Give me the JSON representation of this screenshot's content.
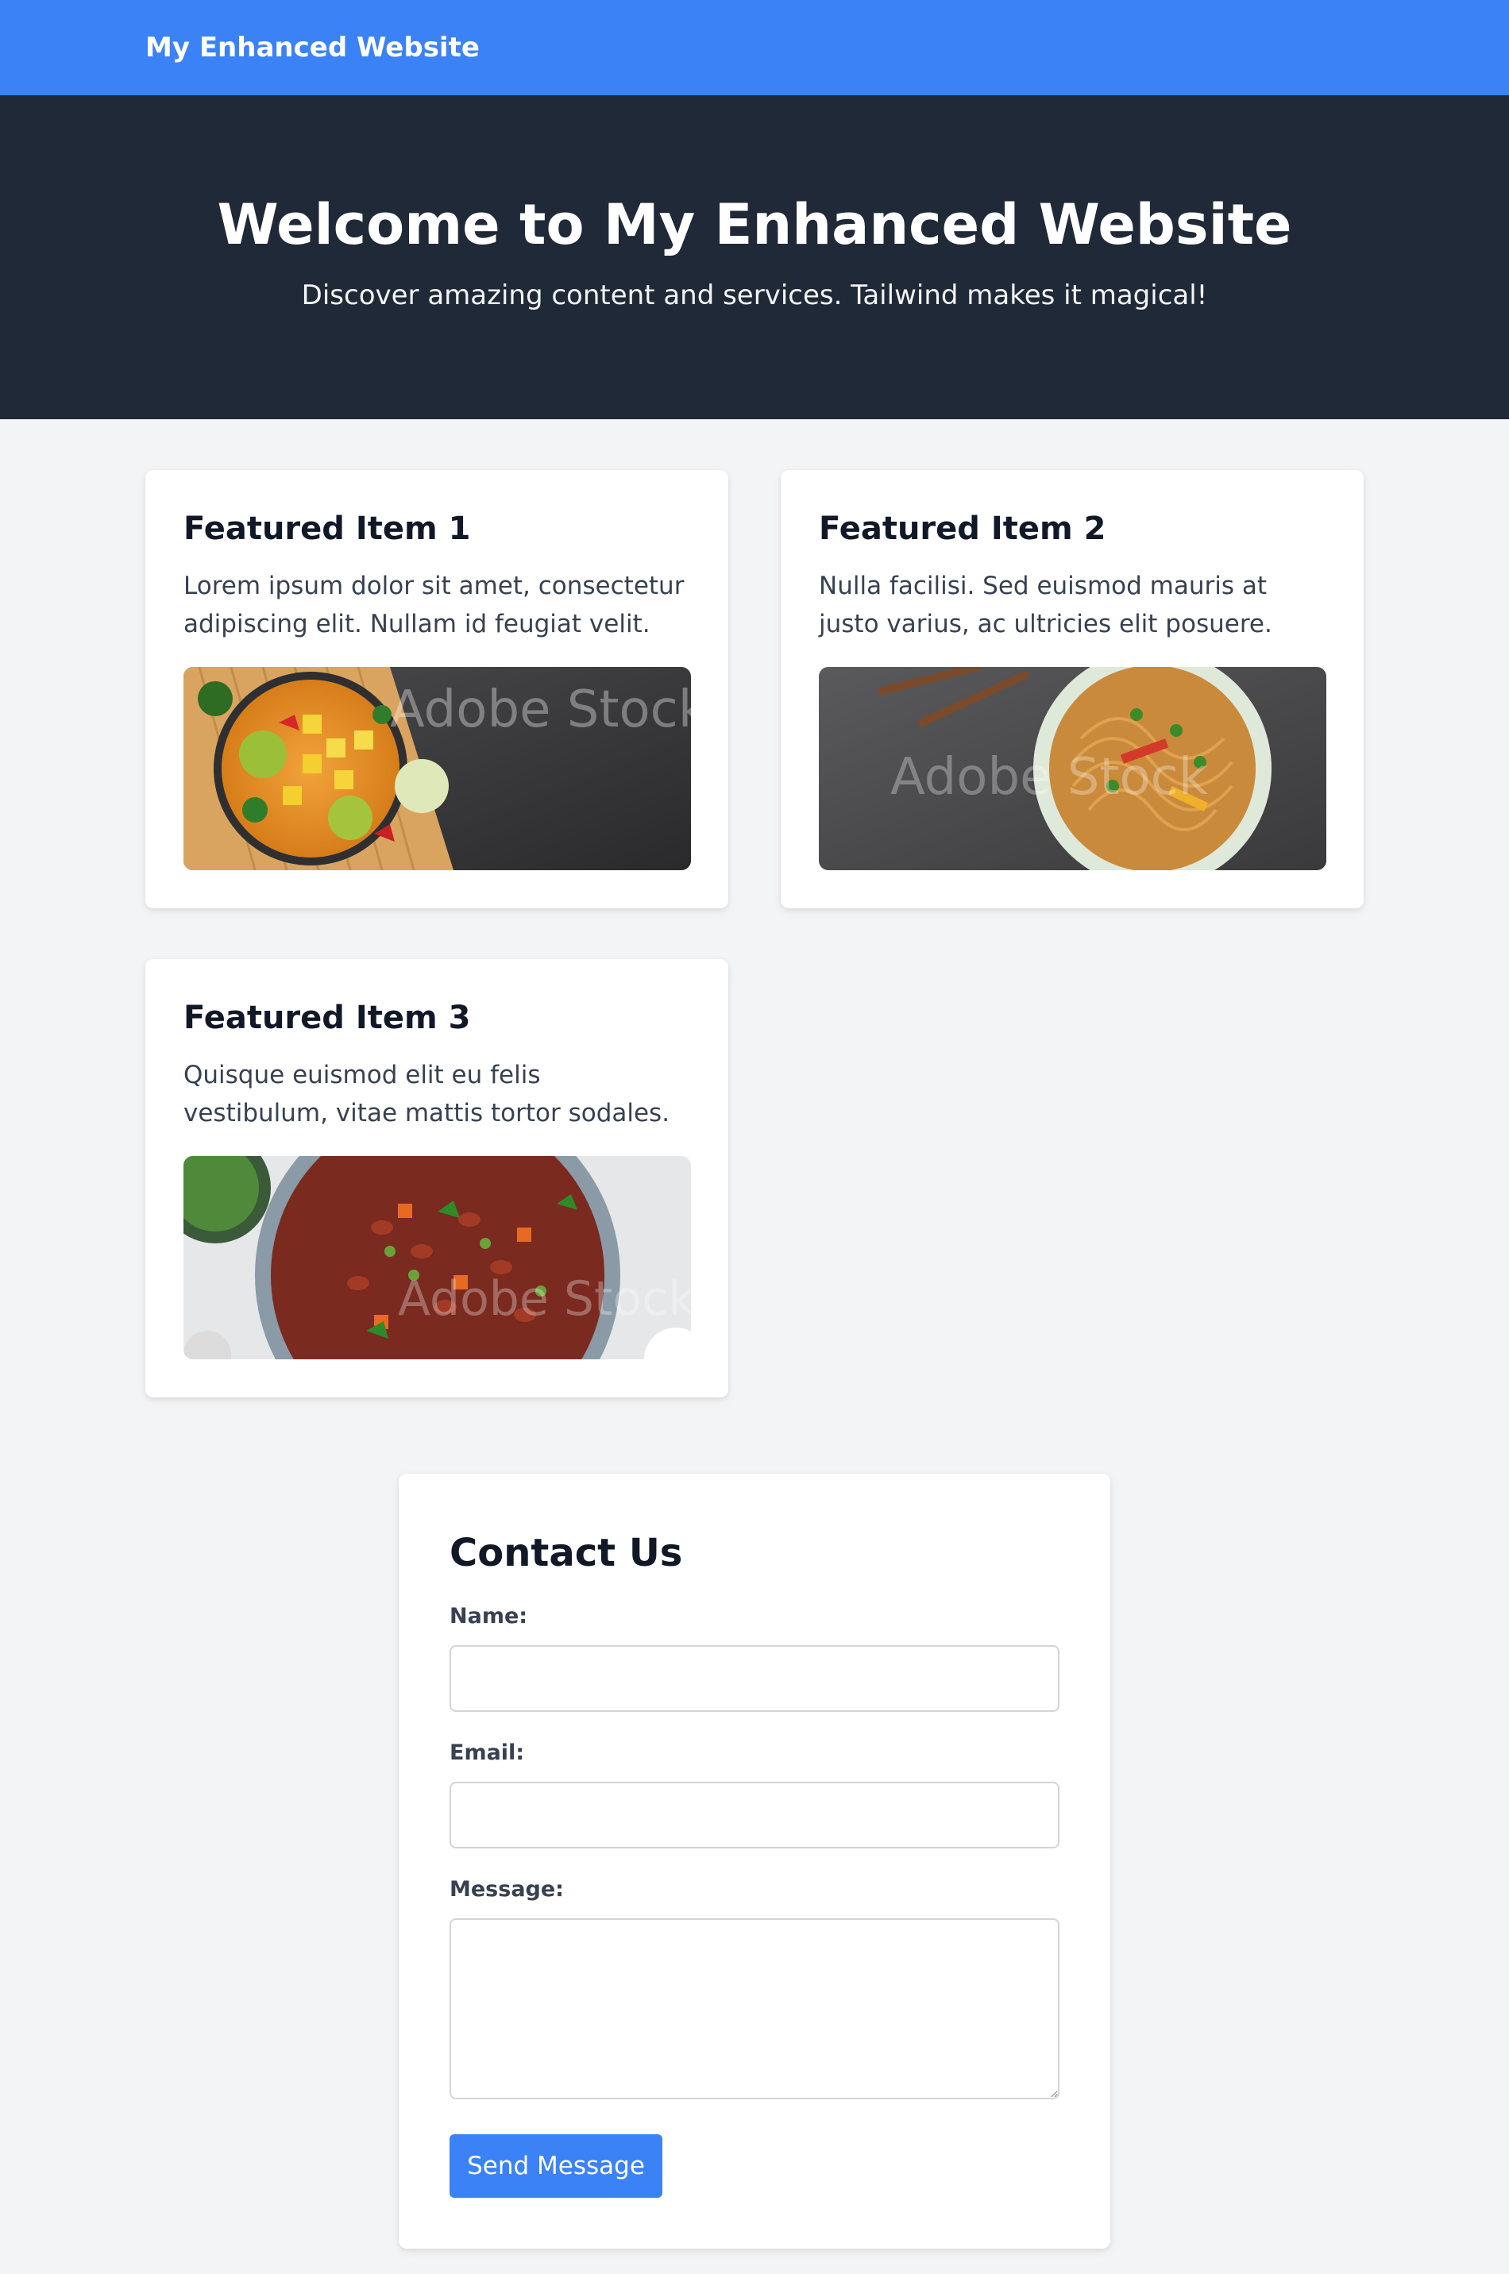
{
  "nav": {
    "brand": "My Enhanced Website",
    "color": "#3b82f6"
  },
  "hero": {
    "title": "Welcome to My Enhanced Website",
    "subtitle": "Discover amazing content and services. Tailwind makes it magical!",
    "background": "#1f2937"
  },
  "features": [
    {
      "title": "Featured Item 1",
      "text": "Lorem ipsum dolor sit amet, consectetur adipiscing elit. Nullam id feugiat velit.",
      "image": "curry-bowl-photo",
      "watermark": "Adobe Stock"
    },
    {
      "title": "Featured Item 2",
      "text": "Nulla facilisi. Sed euismod mauris at justo varius, ac ultricies elit posuere.",
      "image": "noodles-bowl-photo",
      "watermark": "Adobe Stock"
    },
    {
      "title": "Featured Item 3",
      "text": "Quisque euismod elit eu felis vestibulum, vitae mattis tortor sodales.",
      "image": "bean-stew-photo",
      "watermark": "Adobe Stock"
    }
  ],
  "contact": {
    "title": "Contact Us",
    "name_label": "Name:",
    "name_value": "",
    "email_label": "Email:",
    "email_value": "",
    "message_label": "Message:",
    "message_value": "",
    "submit_label": "Send Message",
    "button_color": "#3b82f6"
  }
}
